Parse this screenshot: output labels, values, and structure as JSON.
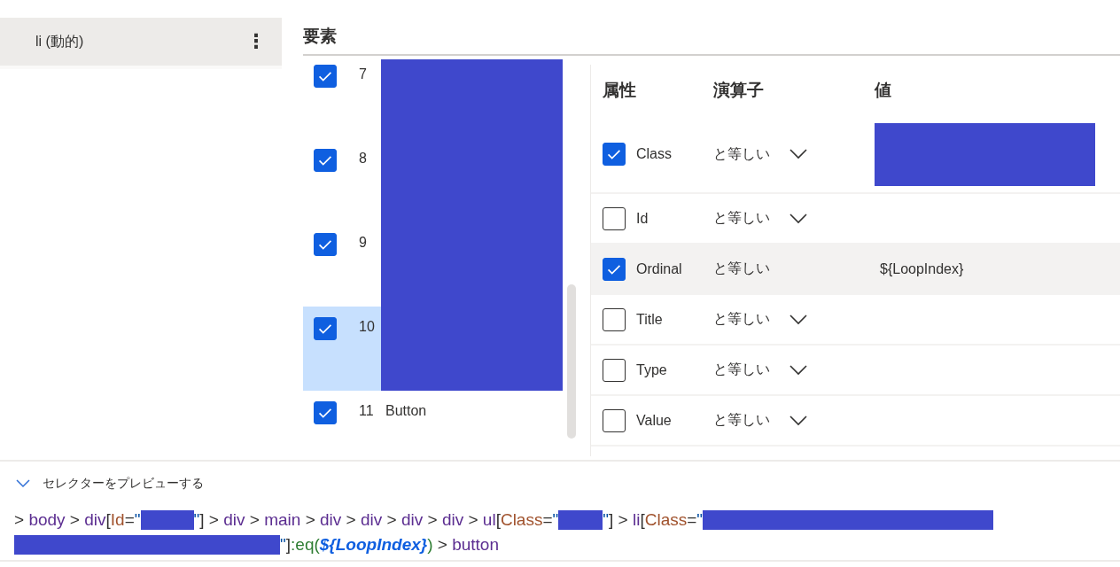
{
  "sidebar": {
    "items": [
      {
        "label": "li (動的)",
        "selected": true,
        "menu": "⋮"
      }
    ]
  },
  "elements": {
    "title": "要素",
    "rows": [
      {
        "checked": true,
        "index": "7",
        "label": "",
        "selected": false
      },
      {
        "checked": true,
        "index": "8",
        "label": "",
        "selected": false
      },
      {
        "checked": true,
        "index": "9",
        "label": "",
        "selected": false
      },
      {
        "checked": true,
        "index": "10",
        "label": "",
        "selected": true
      },
      {
        "checked": true,
        "index": "11",
        "label": "Button",
        "selected": false
      }
    ]
  },
  "attributes": {
    "columns": [
      "属性",
      "演算子",
      "値"
    ],
    "rows": [
      {
        "checked": true,
        "name": "Class",
        "operator": "と等しい",
        "dropdown": true,
        "value": "",
        "value_redacted": true,
        "selected": false
      },
      {
        "checked": false,
        "name": "Id",
        "operator": "と等しい",
        "dropdown": true,
        "value": "",
        "value_redacted": false,
        "selected": false
      },
      {
        "checked": true,
        "name": "Ordinal",
        "operator": "と等しい",
        "dropdown": false,
        "value": "${LoopIndex}",
        "value_redacted": false,
        "selected": true
      },
      {
        "checked": false,
        "name": "Title",
        "operator": "と等しい",
        "dropdown": true,
        "value": "",
        "value_redacted": false,
        "selected": false
      },
      {
        "checked": false,
        "name": "Type",
        "operator": "と等しい",
        "dropdown": true,
        "value": "",
        "value_redacted": false,
        "selected": false
      },
      {
        "checked": false,
        "name": "Value",
        "operator": "と等しい",
        "dropdown": true,
        "value": "",
        "value_redacted": false,
        "selected": false
      }
    ]
  },
  "preview": {
    "title": "セレクターをプレビューする",
    "expanded": true,
    "lines": [
      [
        {
          "kind": "plain",
          "text": "> "
        },
        {
          "kind": "tag",
          "text": "body"
        },
        {
          "kind": "plain",
          "text": " > "
        },
        {
          "kind": "tag",
          "text": "div"
        },
        {
          "kind": "plain",
          "text": "["
        },
        {
          "kind": "attr",
          "text": "Id"
        },
        {
          "kind": "plain",
          "text": "="
        },
        {
          "kind": "quote",
          "text": "\""
        },
        {
          "kind": "redact-s"
        },
        {
          "kind": "quote",
          "text": "\""
        },
        {
          "kind": "plain",
          "text": "] > "
        },
        {
          "kind": "tag",
          "text": "div"
        },
        {
          "kind": "plain",
          "text": " > "
        },
        {
          "kind": "tag",
          "text": "main"
        },
        {
          "kind": "plain",
          "text": " > "
        },
        {
          "kind": "tag",
          "text": "div"
        },
        {
          "kind": "plain",
          "text": " > "
        },
        {
          "kind": "tag",
          "text": "div"
        },
        {
          "kind": "plain",
          "text": " > "
        },
        {
          "kind": "tag",
          "text": "div"
        },
        {
          "kind": "plain",
          "text": " > "
        },
        {
          "kind": "tag",
          "text": "div"
        },
        {
          "kind": "plain",
          "text": " > "
        },
        {
          "kind": "tag",
          "text": "ul"
        },
        {
          "kind": "plain",
          "text": "["
        },
        {
          "kind": "attr",
          "text": "Class"
        },
        {
          "kind": "plain",
          "text": "="
        },
        {
          "kind": "quote",
          "text": "\""
        },
        {
          "kind": "redact-m"
        },
        {
          "kind": "quote",
          "text": "\""
        },
        {
          "kind": "plain",
          "text": "] > "
        },
        {
          "kind": "tag",
          "text": "li"
        },
        {
          "kind": "plain",
          "text": "["
        },
        {
          "kind": "attr",
          "text": "Class"
        },
        {
          "kind": "plain",
          "text": "="
        },
        {
          "kind": "quote",
          "text": "\""
        },
        {
          "kind": "redact-l"
        }
      ],
      [
        {
          "kind": "redact-w"
        },
        {
          "kind": "quote",
          "text": "\""
        },
        {
          "kind": "plain",
          "text": "]"
        },
        {
          "kind": "fn",
          "text": ":eq("
        },
        {
          "kind": "var",
          "text": "${LoopIndex}"
        },
        {
          "kind": "fn",
          "text": ")"
        },
        {
          "kind": "plain",
          "text": " > "
        },
        {
          "kind": "tag",
          "text": "button"
        }
      ]
    ]
  }
}
